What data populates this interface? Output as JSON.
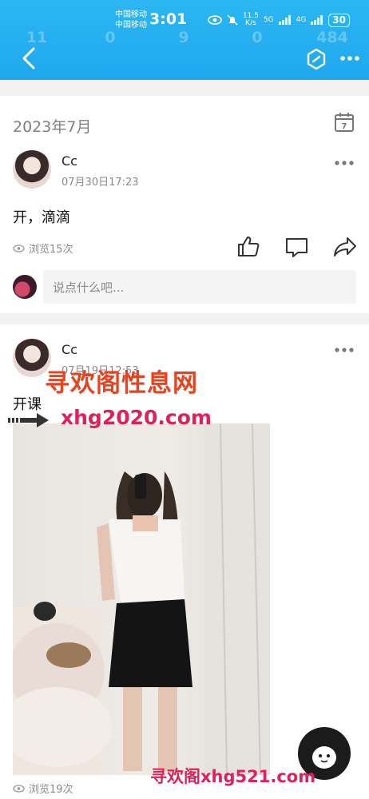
{
  "status_bar": {
    "carrier_1": "中国移动",
    "carrier_2": "中国移动",
    "time": "3:01",
    "speed": "11.5",
    "speed_unit": "K/s",
    "net1": "5G",
    "net2": "4G",
    "battery": "30"
  },
  "header": {
    "stats": [
      {
        "num": "11",
        "label": "..."
      },
      {
        "num": "0",
        "label": "..."
      },
      {
        "num": "9",
        "label": "..."
      },
      {
        "num": "0",
        "label": "..."
      },
      {
        "num": "484",
        "label": "..."
      }
    ]
  },
  "month_label": "2023年7月",
  "calendar_day": "7",
  "posts": [
    {
      "user": "Cc",
      "time": "07月30日17:23",
      "text": "开，滴滴",
      "views": "浏览15次"
    },
    {
      "user": "Cc",
      "time": "07月19日12:53",
      "text": "开课",
      "views": "浏览19次"
    }
  ],
  "comment_placeholder": "说点什么吧...",
  "watermarks": {
    "line1": "寻欢阁性息网",
    "line2": "xhg2020.com",
    "line3": "寻欢阁xhg521.com"
  }
}
